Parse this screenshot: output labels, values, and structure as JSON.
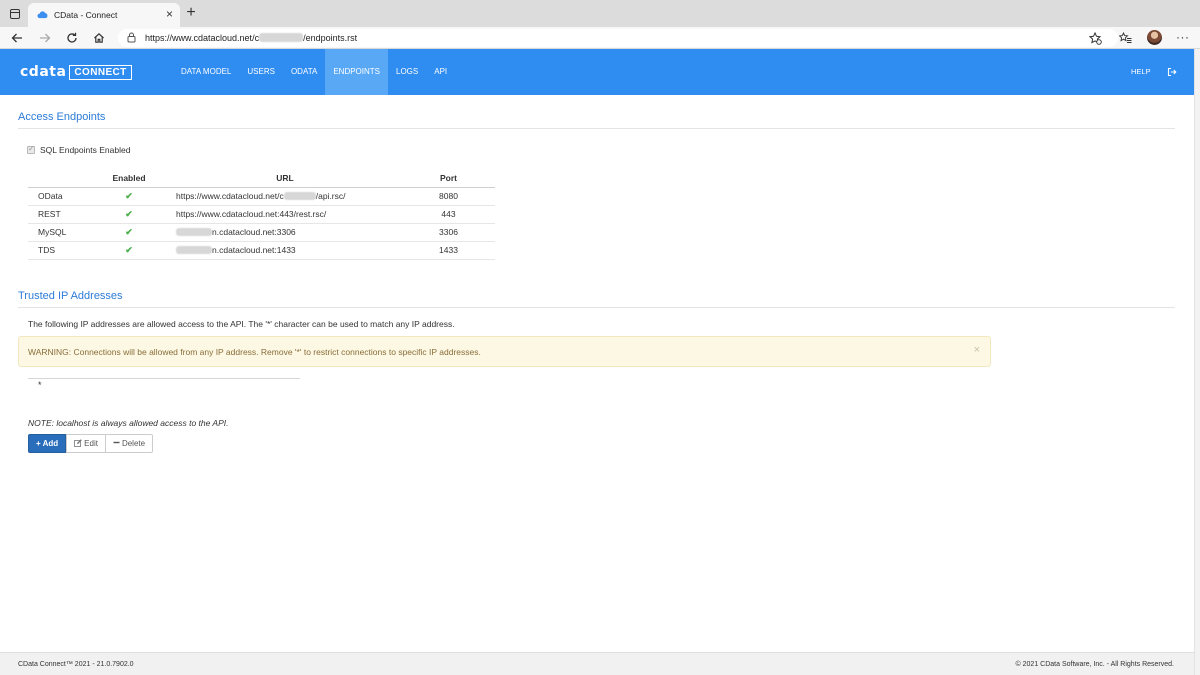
{
  "browser": {
    "tab_title": "CData - Connect",
    "tab_close": "×",
    "new_tab": "+",
    "url_prefix": "https://www.cdatacloud.net/",
    "url_bold": "https://www.cdatacloud.net",
    "url_slash": "/",
    "url_char": "c",
    "url_suffix": "/endpoints.rst",
    "menu_dots": "···"
  },
  "app": {
    "logo_text": "cdata",
    "logo_badge": "CONNECT",
    "nav": [
      "DATA MODEL",
      "USERS",
      "ODATA",
      "ENDPOINTS",
      "LOGS",
      "API"
    ],
    "active_nav": "ENDPOINTS",
    "help": "HELP"
  },
  "access": {
    "title": "Access Endpoints",
    "sql_label": "SQL Endpoints Enabled",
    "headers": {
      "enabled": "Enabled",
      "url": "URL",
      "port": "Port"
    },
    "check_glyph": "✔",
    "rows": [
      {
        "name": "OData",
        "url_a": "https://www.cdatacloud.net/c",
        "url_b": "/api.rsc/",
        "port": "8080"
      },
      {
        "name": "REST",
        "url_a": "https://www.cdatacloud.net:443/rest.rsc/",
        "url_b": "",
        "port": "443"
      },
      {
        "name": "MySQL",
        "url_a": "",
        "url_b": "n.cdatacloud.net:3306",
        "port": "3306"
      },
      {
        "name": "TDS",
        "url_a": "",
        "url_b": "n.cdatacloud.net:1433",
        "port": "1433"
      }
    ]
  },
  "trusted": {
    "title": "Trusted IP Addresses",
    "description": "The following IP addresses are allowed access to the API. The '*' character can be used to match any IP address.",
    "warning": "WARNING: Connections will be allowed from any IP address. Remove '*' to restrict connections to specific IP addresses.",
    "warning_close": "×",
    "ip_list": [
      "*"
    ],
    "note": "NOTE: localhost is always allowed access to the API.",
    "buttons": {
      "add": "+ Add",
      "edit": "Edit",
      "delete": "Delete"
    }
  },
  "footer": {
    "left": "CData Connect™ 2021 - 21.0.7902.0",
    "right": "© 2021 CData Software, Inc. - All Rights Reserved."
  },
  "colors": {
    "header_blue": "#2f8cf0",
    "active_nav": "#58a8f6",
    "title_blue": "#2b7bd8",
    "check_green": "#4cae4c",
    "warning_bg": "#fcf8e3",
    "warning_text": "#8a6d3b",
    "primary_button": "#2a6ebb"
  }
}
